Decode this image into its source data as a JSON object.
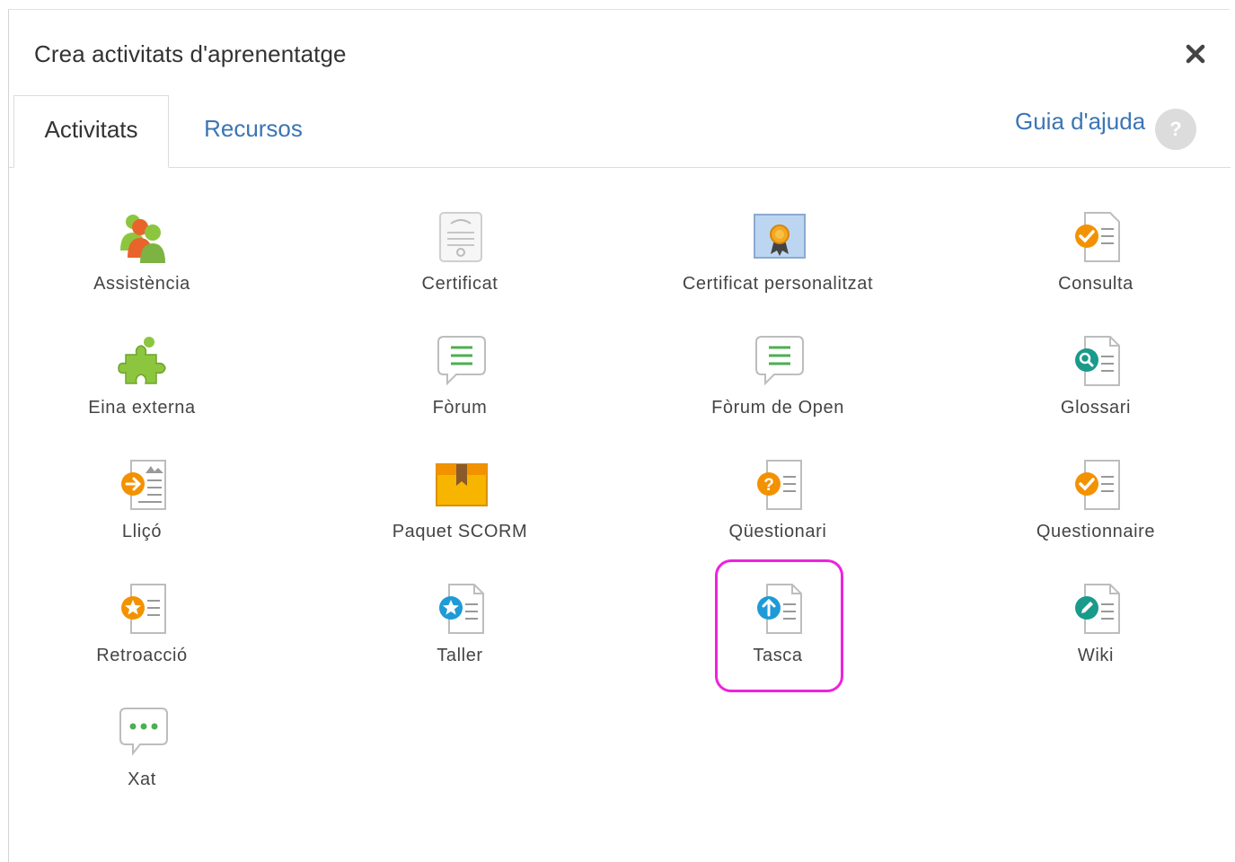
{
  "dialog": {
    "title": "Crea activitats d'aprenentatge",
    "close_icon": "close-icon"
  },
  "tabs": [
    {
      "label": "Activitats",
      "active": true
    },
    {
      "label": "Recursos",
      "active": false
    }
  ],
  "help": {
    "label": "Guia d'ajuda",
    "badge": "?"
  },
  "colors": {
    "link": "#3b75b5",
    "highlight": "#ee22dd"
  },
  "activities": [
    {
      "label": "Assistència",
      "icon": "attendance-icon"
    },
    {
      "label": "Certificat",
      "icon": "certificate-icon"
    },
    {
      "label": "Certificat personalitzat",
      "icon": "custom-certificate-icon"
    },
    {
      "label": "Consulta",
      "icon": "choice-icon"
    },
    {
      "label": "Eina externa",
      "icon": "external-tool-icon"
    },
    {
      "label": "Fòrum",
      "icon": "forum-icon"
    },
    {
      "label": "Fòrum de Open",
      "icon": "open-forum-icon"
    },
    {
      "label": "Glossari",
      "icon": "glossary-icon"
    },
    {
      "label": "Lliçó",
      "icon": "lesson-icon"
    },
    {
      "label": "Paquet SCORM",
      "icon": "scorm-package-icon"
    },
    {
      "label": "Qüestionari",
      "icon": "quiz-icon"
    },
    {
      "label": "Questionnaire",
      "icon": "questionnaire-icon"
    },
    {
      "label": "Retroacció",
      "icon": "feedback-icon"
    },
    {
      "label": "Taller",
      "icon": "workshop-icon"
    },
    {
      "label": "Tasca",
      "icon": "assignment-icon",
      "highlighted": true
    },
    {
      "label": "Wiki",
      "icon": "wiki-icon"
    },
    {
      "label": "Xat",
      "icon": "chat-icon"
    }
  ]
}
